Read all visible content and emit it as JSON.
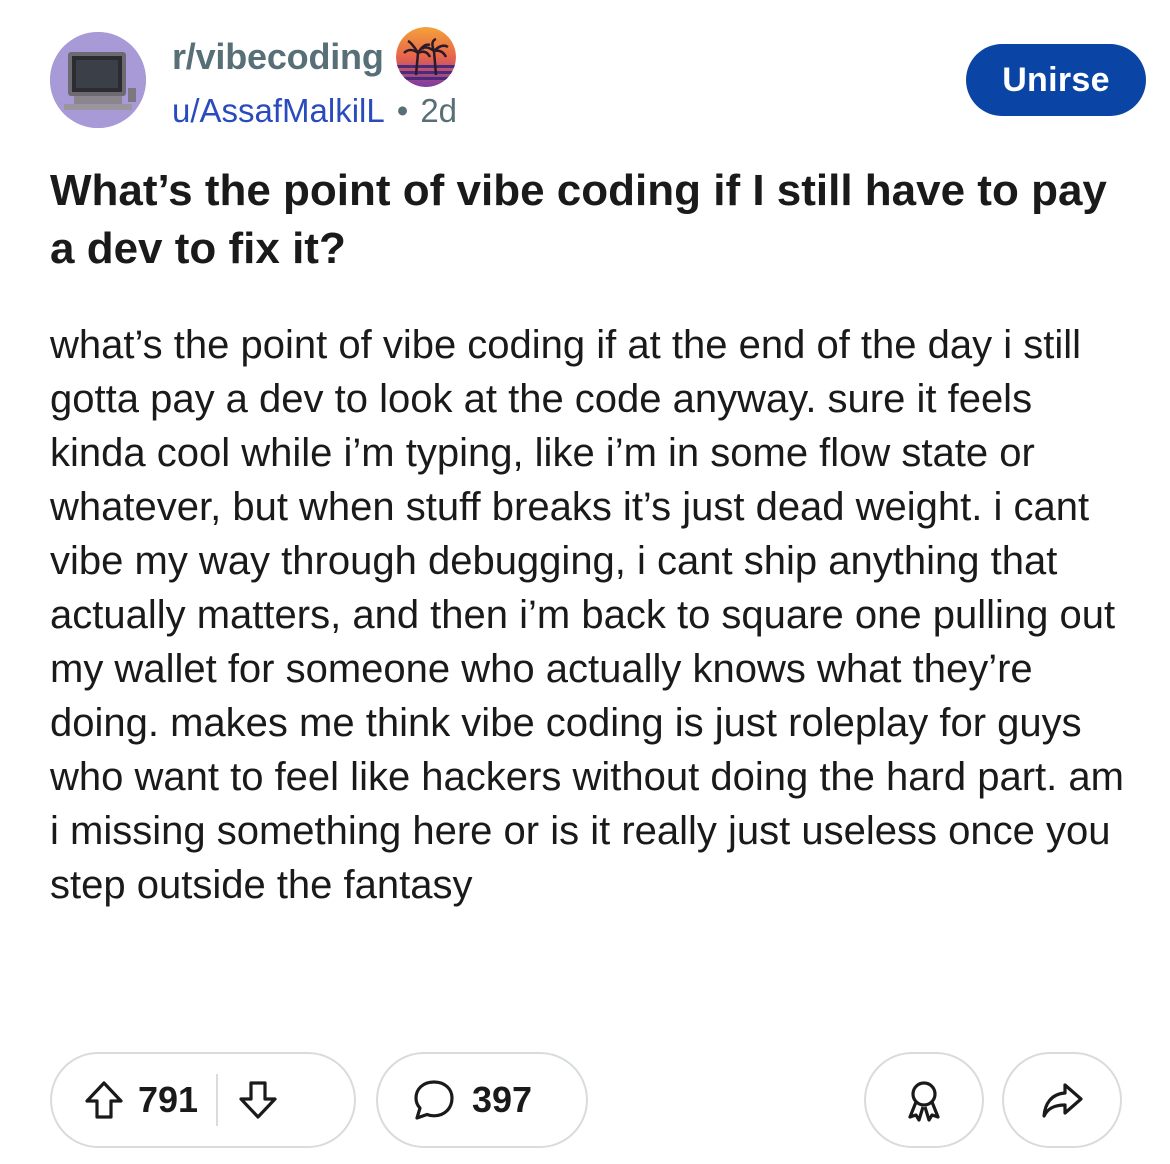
{
  "post": {
    "subreddit": "r/vibecoding",
    "username": "u/AssafMalkilL",
    "separator": "•",
    "time_ago": "2d",
    "join_label": "Unirse",
    "title": "What’s the point of vibe coding if I still have to pay a dev to fix it?",
    "body": "what’s the point of vibe coding if at the end of the day i still gotta pay a dev to look at the code anyway. sure it feels kinda cool while i’m typing, like i’m in some flow state or whatever, but when stuff breaks it’s just dead weight. i cant vibe my way through debugging, i cant ship anything that actually matters, and then i’m back to square one pulling out my wallet for someone who actually knows what they’re doing. makes me think vibe coding is just roleplay for guys who want to feel like hackers without doing the hard part. am i missing something here or is it really just useless once you step outside the fantasy"
  },
  "actions": {
    "upvotes": "791",
    "comments": "397",
    "icons": {
      "upvote": "upvote-arrow-icon",
      "downvote": "downvote-arrow-icon",
      "comment": "comment-bubble-icon",
      "award": "award-ribbon-icon",
      "share": "share-arrow-icon"
    }
  },
  "colors": {
    "join_button": "#0a45a6",
    "username": "#2a4bbd",
    "muted": "#576f76",
    "text": "#1a1a1b",
    "avatar_bg": "#a89ad6"
  }
}
